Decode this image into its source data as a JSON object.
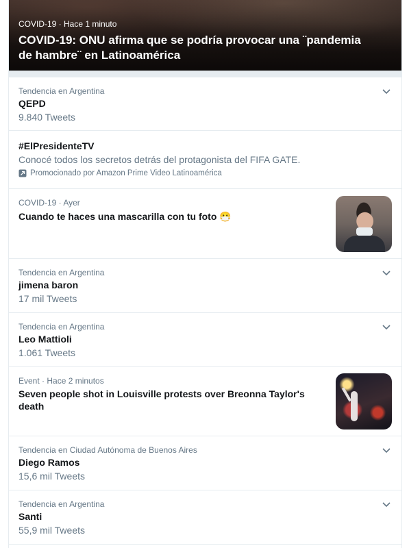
{
  "hero": {
    "meta": "COVID-19 · Hace 1 minuto",
    "title": "COVID-19: ONU afirma que se podría provocar una ¨pandemia de hambre¨ en Latinoamérica"
  },
  "trends": [
    {
      "sub": "Tendencia en Argentina",
      "name": "QEPD",
      "count": "9.840 Tweets"
    },
    {
      "name": "#ElPresidenteTV",
      "desc": "Conocé todos los secretos detrás del protagonista del FIFA GATE.",
      "promo": "Promocionado por Amazon Prime Video Latinoamérica"
    },
    {
      "sub": "COVID-19 · Ayer",
      "name": "Cuando te haces una mascarilla con tu foto 😷"
    },
    {
      "sub": "Tendencia en Argentina",
      "name": "jimena baron",
      "count": "17 mil Tweets"
    },
    {
      "sub": "Tendencia en Argentina",
      "name": "Leo Mattioli",
      "count": "1.061 Tweets"
    },
    {
      "sub": "Event · Hace 2 minutos",
      "name": "Seven people shot in Louisville protests over Breonna Taylor's death"
    },
    {
      "sub": "Tendencia en Ciudad Autónoma de Buenos Aires",
      "name": "Diego Ramos",
      "count": "15,6 mil Tweets"
    },
    {
      "sub": "Tendencia en Argentina",
      "name": "Santi",
      "count": "55,9 mil Tweets"
    }
  ],
  "icons": {
    "chevron": "chevron-down-icon",
    "promoted": "promoted-icon"
  },
  "colors": {
    "secondary_text": "#657786",
    "primary_text": "#14171a",
    "divider": "#e6ecf0"
  }
}
